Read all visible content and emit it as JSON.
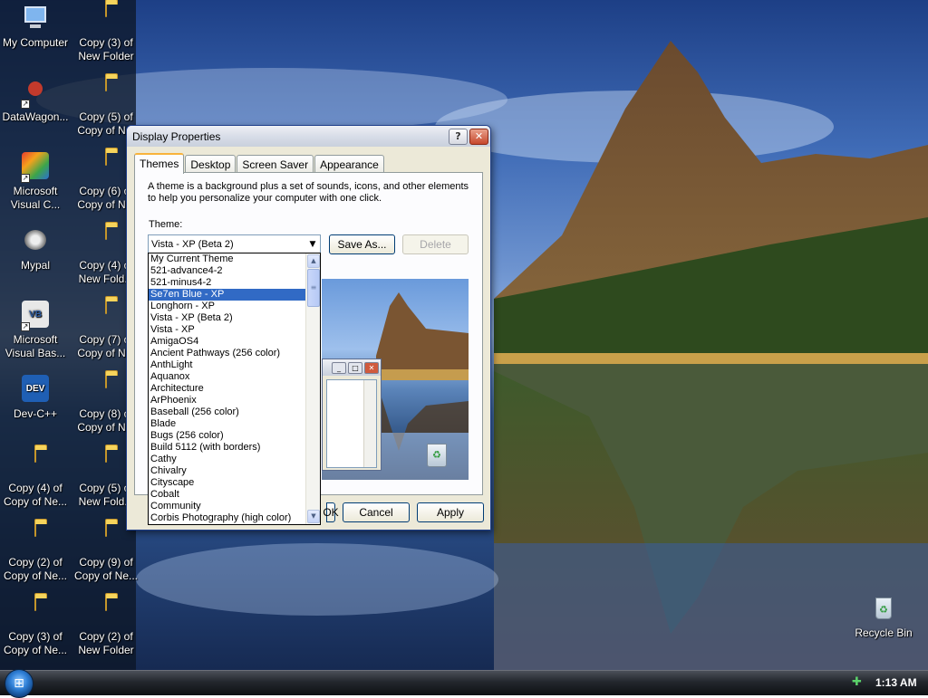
{
  "desktop": {
    "icons": [
      {
        "label": "My Computer",
        "icon": "computer-icon"
      },
      {
        "label": "DataWagon...",
        "icon": "datawagon-icon"
      },
      {
        "label": "Microsoft Visual C...",
        "icon": "visual-c-icon"
      },
      {
        "label": "Mypal",
        "icon": "mypal-icon"
      },
      {
        "label": "Microsoft Visual Bas...",
        "icon": "visual-basic-icon"
      },
      {
        "label": "Dev-C++",
        "icon": "devcpp-icon"
      },
      {
        "label": "Copy (4) of Copy of Ne...",
        "icon": "folder-icon"
      },
      {
        "label": "Copy (2) of Copy of Ne...",
        "icon": "folder-icon"
      },
      {
        "label": "Copy (3) of Copy of Ne...",
        "icon": "folder-icon"
      },
      {
        "label": "Copy (3) of New Folder",
        "icon": "folder-icon"
      },
      {
        "label": "Copy (5) of Copy of N...",
        "icon": "folder-icon"
      },
      {
        "label": "Copy (6) of Copy of N...",
        "icon": "folder-icon"
      },
      {
        "label": "Copy (4) of New Fold...",
        "icon": "folder-icon"
      },
      {
        "label": "Copy (7) of Copy of N...",
        "icon": "folder-icon"
      },
      {
        "label": "Copy (8) of Copy of N...",
        "icon": "folder-icon"
      },
      {
        "label": "Copy (5) of New Fold...",
        "icon": "folder-icon"
      },
      {
        "label": "Copy (9) of Copy of Ne...",
        "icon": "folder-icon"
      },
      {
        "label": "Copy (2) of New Folder",
        "icon": "folder-icon"
      },
      {
        "label": "Recycle Bin",
        "icon": "recycle-bin-icon"
      }
    ]
  },
  "window": {
    "title": "Display Properties",
    "tabs": [
      "Themes",
      "Desktop",
      "Screen Saver",
      "Appearance"
    ],
    "active_tab": "Themes",
    "description": "A theme is a background plus a set of sounds, icons, and other elements to help you personalize your computer with one click.",
    "theme_label": "Theme:",
    "theme_value": "Vista - XP (Beta 2)",
    "save_as_label": "Save As...",
    "delete_label": "Delete",
    "ok_label": "OK",
    "cancel_label": "Cancel",
    "apply_label": "Apply",
    "help_button": "?",
    "close_button": "✕"
  },
  "theme_list": {
    "selected": "Se7en Blue - XP",
    "items": [
      "My Current Theme",
      "521-advance4-2",
      "521-minus4-2",
      "Se7en Blue - XP",
      "Longhorn - XP",
      "Vista - XP (Beta 2)",
      "Vista - XP",
      "AmigaOS4",
      "Ancient Pathways (256 color)",
      "AnthLight",
      "Aquanox",
      "Architecture",
      "ArPhoenix",
      "Baseball (256 color)",
      "Blade",
      "Bugs (256 color)",
      "Build 5112 (with borders)",
      "Cathy",
      "Chivalry",
      "Cityscape",
      "Cobalt",
      "Community",
      "Corbis Photography (high color)"
    ]
  },
  "taskbar": {
    "clock": "1:13 AM"
  },
  "colors": {
    "selection": "#316ac5",
    "window_face": "#ece9d8",
    "titlebar_close": "#c6472c"
  }
}
